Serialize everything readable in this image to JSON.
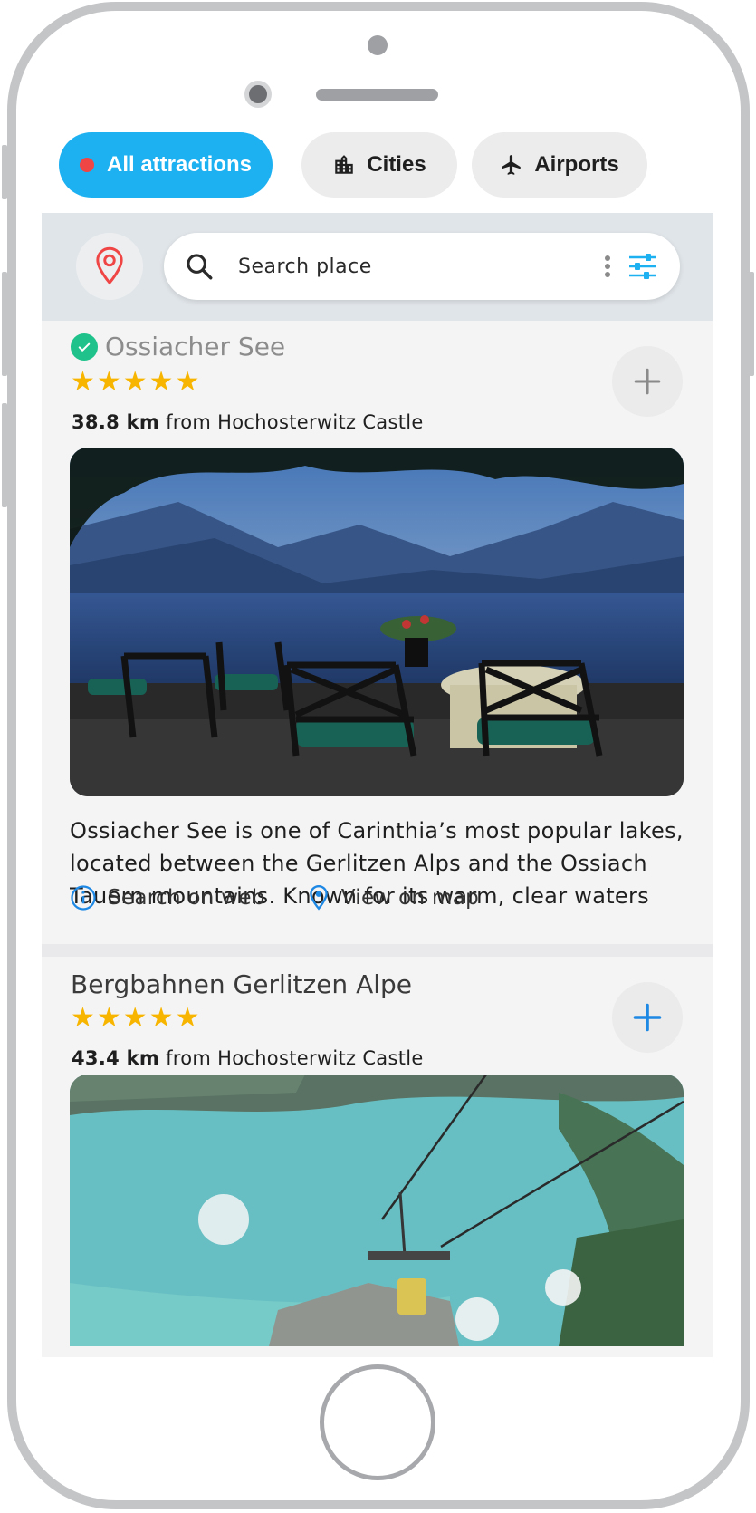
{
  "filters": {
    "chips": [
      {
        "label": "All attractions",
        "icon": "red-dot",
        "active": true
      },
      {
        "label": "Cities",
        "icon": "city-icon",
        "active": false
      },
      {
        "label": "Airports",
        "icon": "airplane-icon",
        "active": false
      }
    ]
  },
  "search": {
    "placeholder": "Search place",
    "value": ""
  },
  "attractions": [
    {
      "name": "Ossiacher See",
      "visited": true,
      "rating": 5,
      "stars": "★★★★★",
      "distance": "38.8 km",
      "distance_suffix": "from Hochosterwitz Castle",
      "description": "Ossiacher See is one of Carinthia’s most popular lakes, located between the Gerlitzen Alps and the Ossiach Tauern mountains. Known for its warm, clear waters",
      "actions": {
        "web": "Search on web",
        "map": "View on map"
      }
    },
    {
      "name": "Bergbahnen Gerlitzen Alpe",
      "visited": false,
      "rating": 5,
      "stars": "★★★★★",
      "distance": "43.4 km",
      "distance_suffix": "from Hochosterwitz Castle"
    }
  ],
  "colors": {
    "accent": "#1db1f2",
    "star": "#f7b500",
    "visited": "#1ec28a",
    "marker": "#f04545",
    "link_icon": "#1e88e5"
  }
}
